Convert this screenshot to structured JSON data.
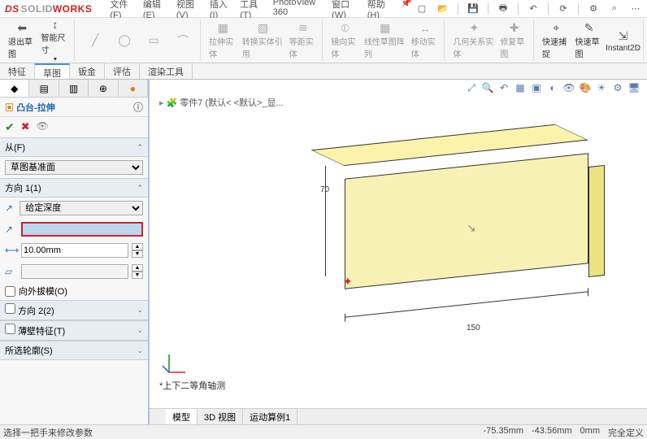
{
  "app": {
    "name_solid": "SOLID",
    "name_works": "WORKS"
  },
  "menu": {
    "file": "文件(F)",
    "edit": "编辑(E)",
    "view": "视图(V)",
    "insert": "插入(I)",
    "tools": "工具(T)",
    "photoview": "PhotoView 360",
    "window": "窗口(W)",
    "help": "帮助(H)"
  },
  "ribbon": {
    "back": "退出草图",
    "smart": "智能尺寸",
    "ext1": "拉伸实体",
    "rev": "转换实体引用",
    "off": "等距实体",
    "mirror": "镜向实体",
    "pattern": "线性草图阵列",
    "move": "移动实体",
    "snap": "几何关系实体",
    "repair": "修复草图",
    "quick": "快速捕捉",
    "rapid": "快速草图",
    "instant": "Instant2D"
  },
  "tabs": {
    "feature": "特征",
    "sketch": "草图",
    "sheetmetal": "钣金",
    "evaluate": "评估",
    "render": "渲染工具"
  },
  "fm": {
    "title": "凸台-拉伸",
    "from": "从(F)",
    "from_option": "草图基准面",
    "dir1": "方向 1(1)",
    "depth_option": "给定深度",
    "depth_value": "",
    "dim_value": "10.00mm",
    "draft": "向外拔模(O)",
    "dir2": "方向 2(2)",
    "thin": "薄壁特征(T)",
    "contours": "所选轮廓(S)"
  },
  "viewport": {
    "breadcrumb": "零件7 (默认< <默认>_显...",
    "viewname": "*上下二等角轴测",
    "dim_w": "150",
    "dim_h": "70"
  },
  "bottomtabs": {
    "model": "模型",
    "view3d": "3D 视图",
    "motion": "运动算例1"
  },
  "status": {
    "hint": "选择一把手来修改参数",
    "x": "-75.35mm",
    "y": "-43.56mm",
    "z": "0mm",
    "mode": "完全定义"
  }
}
